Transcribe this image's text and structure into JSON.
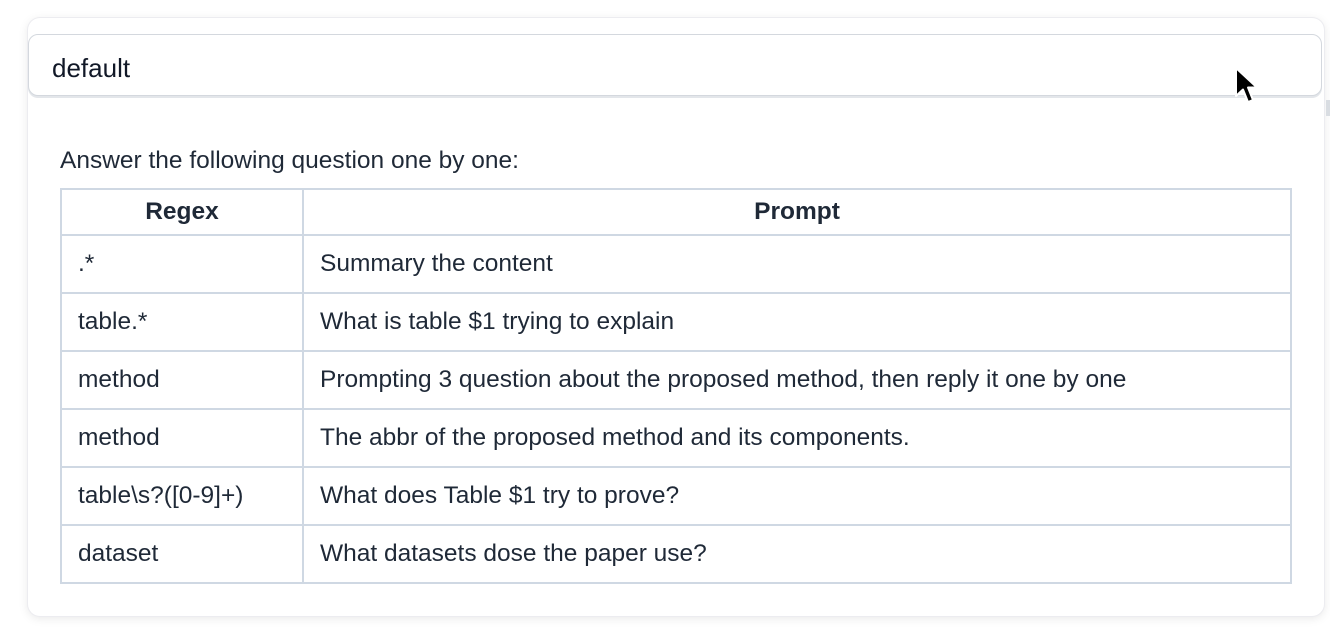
{
  "dropdown": {
    "value": "default"
  },
  "intro_text": "Answer the following question one by one:",
  "table": {
    "headers": [
      "Regex",
      "Prompt"
    ],
    "rows": [
      {
        "regex": ".*",
        "prompt": "Summary the content"
      },
      {
        "regex": "table.*",
        "prompt": "What is table $1 trying to explain"
      },
      {
        "regex": "method",
        "prompt": "Prompting 3 question about the proposed method, then reply it one by one"
      },
      {
        "regex": "method",
        "prompt": "The abbr of the proposed method and its components."
      },
      {
        "regex": "table\\s?([0-9]+)",
        "prompt": "What does Table $1 try to prove?"
      },
      {
        "regex": "dataset",
        "prompt": "What datasets dose the paper use?"
      }
    ]
  },
  "icons": {
    "cursor": "mouse-pointer-icon"
  }
}
